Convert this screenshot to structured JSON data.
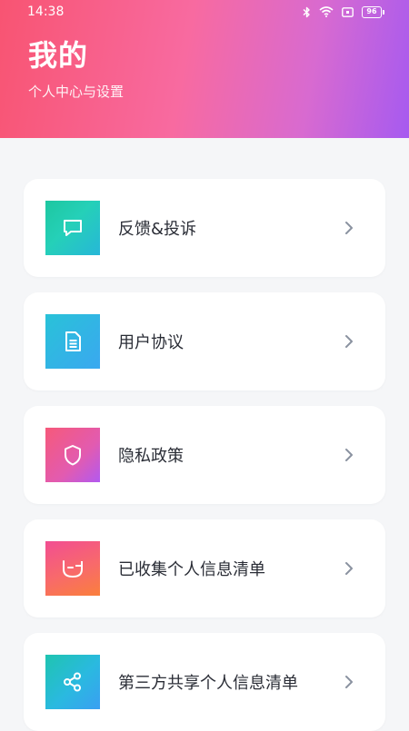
{
  "status_bar": {
    "time": "14:38",
    "battery": "96",
    "icons": [
      "bluetooth-icon",
      "wifi-icon",
      "sim-icon",
      "battery-icon"
    ]
  },
  "header": {
    "title": "我的",
    "subtitle": "个人中心与设置",
    "gradient_colors": [
      "#f85472",
      "#f86aa0",
      "#d86ad0",
      "#a65af0"
    ]
  },
  "menu": {
    "items": [
      {
        "label": "反馈&投诉",
        "icon": "chat-bubble-icon"
      },
      {
        "label": "用户协议",
        "icon": "document-icon"
      },
      {
        "label": "隐私政策",
        "icon": "shield-icon"
      },
      {
        "label": "已收集个人信息清单",
        "icon": "collection-bowl-icon"
      },
      {
        "label": "第三方共享个人信息清单",
        "icon": "share-icon"
      }
    ]
  },
  "colors": {
    "page_background": "#f5f6f8",
    "card_background": "#ffffff",
    "label_text": "#2a2d36",
    "chevron": "#8a92a0"
  }
}
